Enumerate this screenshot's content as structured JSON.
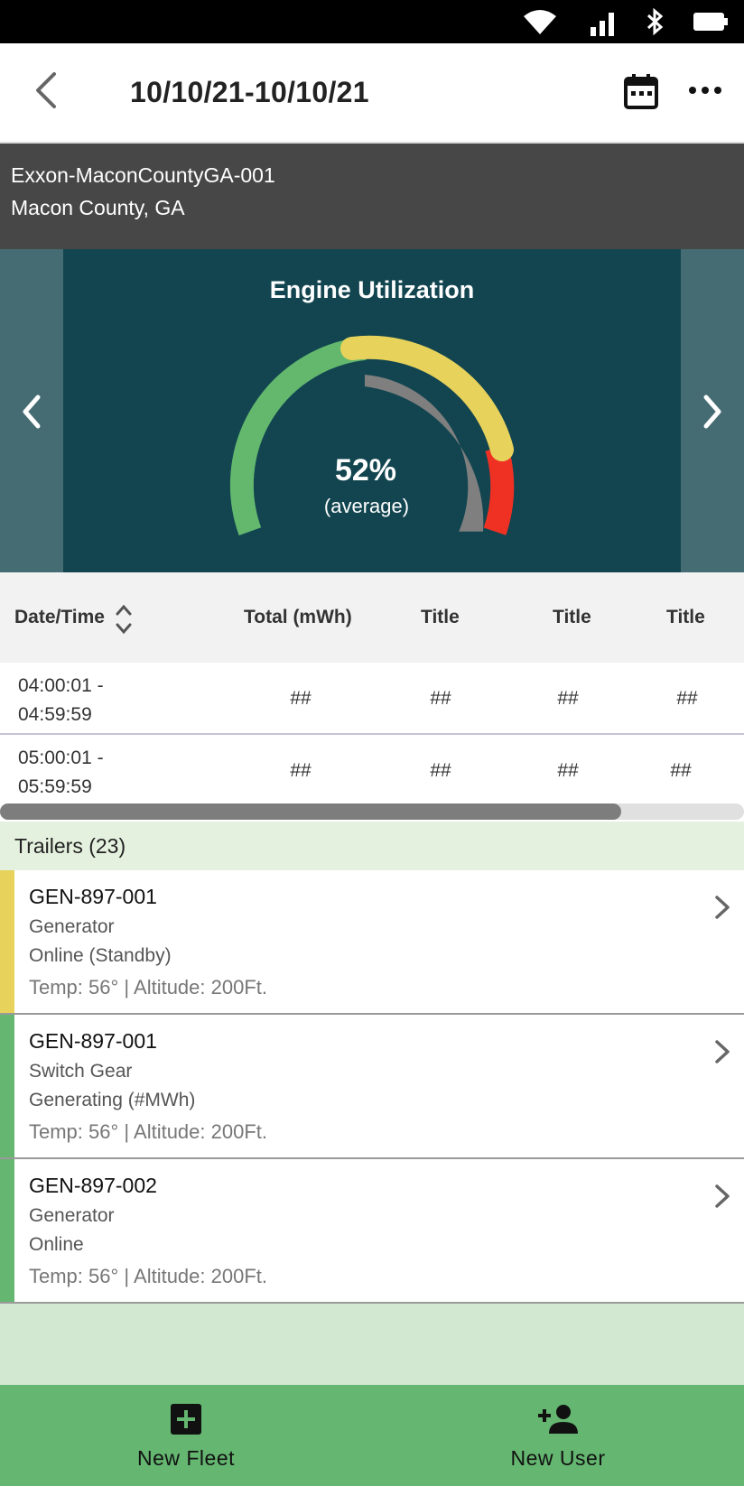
{
  "header": {
    "title": "10/10/21-10/10/21",
    "back_icon": "arrow-back-icon",
    "calendar_icon": "calendar-icon",
    "more_icon": "more-horizontal-icon"
  },
  "site": {
    "name": "Exxon-MaconCountyGA-001",
    "location": "Macon County, GA"
  },
  "gauge": {
    "title": "Engine Utilization",
    "value_text": "52%",
    "subtitle": "(average)",
    "value": 52,
    "colors": {
      "green": "#63b86e",
      "yellow": "#e7d25b",
      "red": "#ef3124",
      "needle_fill": "#7f7f7f",
      "card": "#124550"
    }
  },
  "table": {
    "columns": [
      "Date/Time",
      "Total (mWh)",
      "Title",
      "Title",
      "Title"
    ],
    "rows": [
      {
        "time": "04:00:01 - 04:59:59",
        "cells": [
          "##",
          "##",
          "##",
          "##"
        ]
      },
      {
        "time": "05:00:01 - 05:59:59",
        "cells": [
          "##",
          "##",
          "##",
          "##"
        ]
      }
    ]
  },
  "trailers": {
    "header": "Trailers (23)",
    "items": [
      {
        "id": "GEN-897-001",
        "type": "Generator",
        "status": "Online (Standby)",
        "meta": "Temp: 56° | Altitude: 200Ft.",
        "accent": "#e7d25b"
      },
      {
        "id": "GEN-897-001",
        "type": "Switch Gear",
        "status": "Generating (#MWh)",
        "meta": "Temp: 56° | Altitude: 200Ft.",
        "accent": "#64b670"
      },
      {
        "id": "GEN-897-002",
        "type": "Generator",
        "status": "Online",
        "meta": "Temp: 56° | Altitude: 200Ft.",
        "accent": "#64b670"
      }
    ]
  },
  "bottom_nav": {
    "new_fleet": "New Fleet",
    "new_user": "New User"
  }
}
